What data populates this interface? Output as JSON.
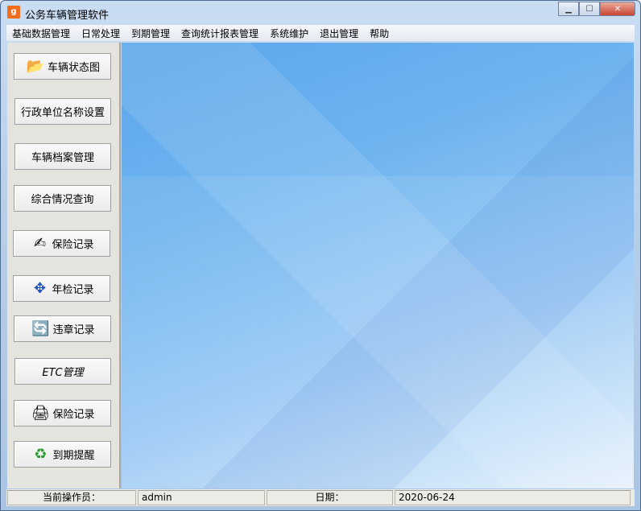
{
  "window": {
    "title": "公务车辆管理软件",
    "icon": "app-icon",
    "min": "▁",
    "max": "☐",
    "close": "✕"
  },
  "menu": [
    "基础数据管理",
    "日常处理",
    "到期管理",
    "查询统计报表管理",
    "系统维护",
    "退出管理",
    "帮助"
  ],
  "sidebar": [
    {
      "label": "车辆状态图",
      "icon": "📂"
    },
    {
      "label": "行政单位名称设置",
      "icon": ""
    },
    {
      "label": "车辆档案管理",
      "icon": ""
    },
    {
      "label": "综合情况查询",
      "icon": ""
    },
    {
      "label": "保险记录",
      "icon": "✍"
    },
    {
      "label": "年检记录",
      "icon": "✥"
    },
    {
      "label": "违章记录",
      "icon": "🔄"
    },
    {
      "label": "ETC管理",
      "icon": ""
    },
    {
      "label": "保险记录",
      "icon": "🖨"
    },
    {
      "label": "到期提醒",
      "icon": "♻"
    }
  ],
  "status": {
    "operator_label": "当前操作员：",
    "operator": "admin",
    "date_label": "日期：",
    "date": "2020-06-24"
  }
}
